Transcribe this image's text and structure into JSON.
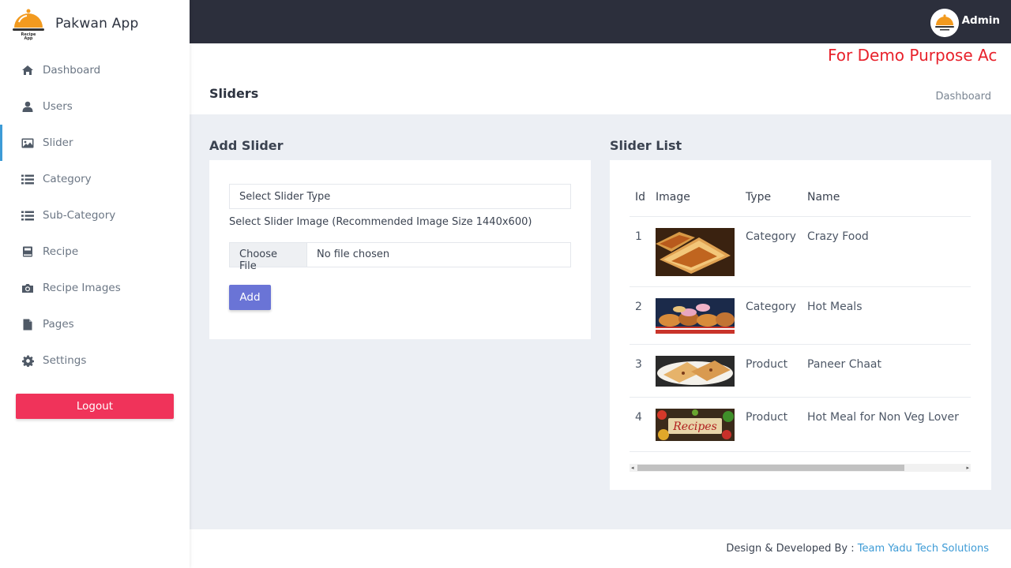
{
  "app": {
    "name": "Pakwan App",
    "logo_text": "Pakwan Recipe App"
  },
  "sidebar": {
    "items": [
      {
        "label": "Dashboard",
        "icon": "home-icon"
      },
      {
        "label": "Users",
        "icon": "user-icon"
      },
      {
        "label": "Slider",
        "icon": "image-icon",
        "active": true
      },
      {
        "label": "Category",
        "icon": "list-icon"
      },
      {
        "label": "Sub-Category",
        "icon": "list-icon"
      },
      {
        "label": "Recipe",
        "icon": "book-icon"
      },
      {
        "label": "Recipe Images",
        "icon": "camera-icon"
      },
      {
        "label": "Pages",
        "icon": "file-icon"
      },
      {
        "label": "Settings",
        "icon": "gear-icon"
      }
    ],
    "logout_label": "Logout"
  },
  "topbar": {
    "user_name": "Admin"
  },
  "header": {
    "marquee": "For Demo Purpose Ac",
    "page_title": "Sliders",
    "breadcrumb": "Dashboard"
  },
  "add_slider": {
    "title": "Add Slider",
    "select_value": "Select Slider Type",
    "image_hint": "Select Slider Image (Recommended Image Size 1440x600)",
    "file_button": "Choose File",
    "file_status": "No file chosen",
    "add_label": "Add"
  },
  "slider_list": {
    "title": "Slider List",
    "columns": [
      "Id",
      "Image",
      "Type",
      "Name"
    ],
    "rows": [
      {
        "id": "1",
        "type": "Category",
        "name": "Crazy Food",
        "image": "grilled-sandwich"
      },
      {
        "id": "2",
        "type": "Category",
        "name": "Hot Meals",
        "image": "donuts-and-burgers"
      },
      {
        "id": "3",
        "type": "Product",
        "name": "Paneer Chaat",
        "image": "quesadilla-plate"
      },
      {
        "id": "4",
        "type": "Product",
        "name": "Hot Meal for Non Veg Lover",
        "image": "recipes-board"
      }
    ]
  },
  "footer": {
    "prefix": "Design & Developed By : ",
    "link": "Team Yadu Tech Solutions"
  },
  "colors": {
    "topbar": "#2c2f3c",
    "logout": "#f0335a",
    "add_button": "#6a74d6",
    "active_bar": "#3d9bd6",
    "marquee": "#e8212b"
  }
}
